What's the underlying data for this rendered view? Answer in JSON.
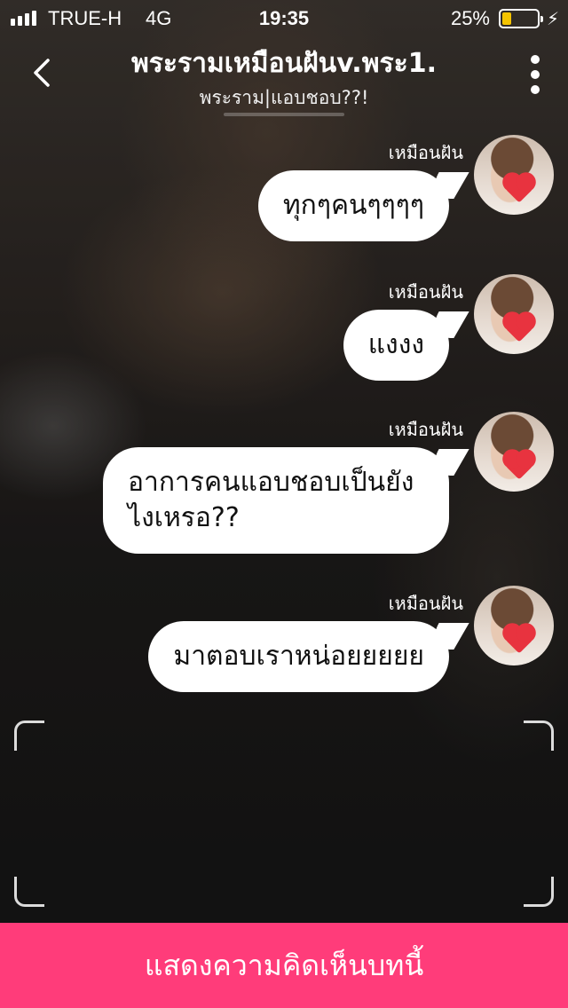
{
  "status_bar": {
    "carrier": "TRUE-H",
    "network": "4G",
    "time": "19:35",
    "battery_percent": "25%",
    "battery_level": 0.25,
    "battery_color": "#f5c400"
  },
  "header": {
    "back_icon": "chevron-left-icon",
    "title": "พระรามเหมือนฝันv.พระ1.",
    "subtitle": "พระราม|แอบชอบ??!",
    "more_icon": "vertical-dots-icon"
  },
  "messages": [
    {
      "sender": "เหมือนฝัน",
      "text": "ทุกๆคนๆๆๆๆ"
    },
    {
      "sender": "เหมือนฝัน",
      "text": "แงงง"
    },
    {
      "sender": "เหมือนฝัน",
      "text": "อาการคนแอบชอบเป็นยังไงเหรอ??"
    },
    {
      "sender": "เหมือนฝัน",
      "text": "มาตอบเราหน่อยยยยย"
    }
  ],
  "cta": {
    "label": "แสดงความคิดเห็นบทนี้",
    "color": "#ff3c7a"
  }
}
